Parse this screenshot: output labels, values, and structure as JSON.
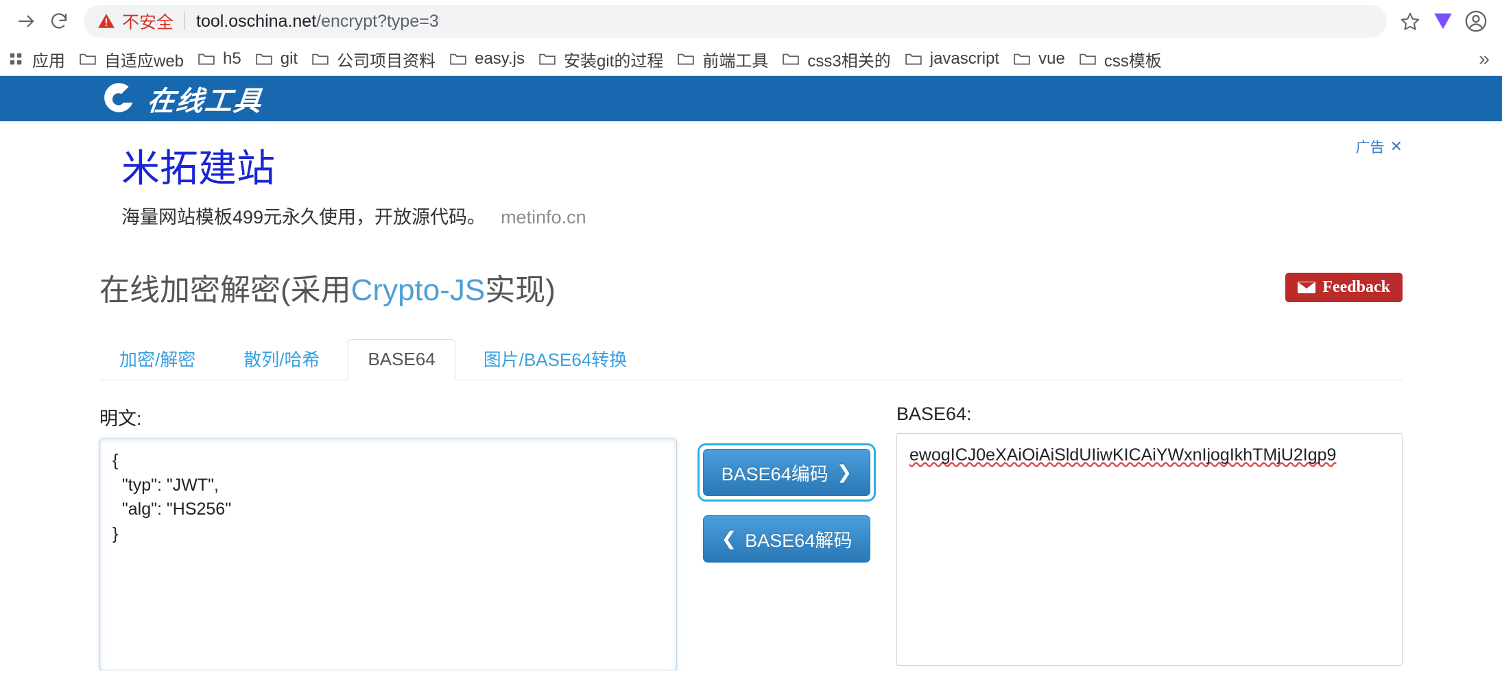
{
  "browser": {
    "back_icon": "back-arrow-icon",
    "forward_icon": "forward-arrow-icon",
    "reload_icon": "reload-icon",
    "security_warning": "不安全",
    "url_host": "tool.oschina.net",
    "url_path": "/encrypt?type=3",
    "star_icon": "bookmark-star-icon",
    "extension_icon": "extension-icon",
    "profile_icon": "profile-avatar-icon",
    "bookmarks": [
      {
        "label": "应用",
        "icon": "apps-icon"
      },
      {
        "label": "自适应web",
        "icon": "folder-icon"
      },
      {
        "label": "h5",
        "icon": "folder-icon"
      },
      {
        "label": "git",
        "icon": "folder-icon"
      },
      {
        "label": "公司项目资料",
        "icon": "folder-icon"
      },
      {
        "label": "easy.js",
        "icon": "folder-icon"
      },
      {
        "label": "安装git的过程",
        "icon": "folder-icon"
      },
      {
        "label": "前端工具",
        "icon": "folder-icon"
      },
      {
        "label": "css3相关的",
        "icon": "folder-icon"
      },
      {
        "label": "javascript",
        "icon": "folder-icon"
      },
      {
        "label": "vue",
        "icon": "folder-icon"
      },
      {
        "label": "css模板",
        "icon": "folder-icon"
      }
    ],
    "bookmarks_overflow": "»"
  },
  "site": {
    "logo_text": "在线工具",
    "header_color": "#1868b0"
  },
  "ad": {
    "badge": "广告",
    "close": "✕",
    "title": "米拓建站",
    "subtitle": "海量网站模板499元永久使用，开放源代码。",
    "domain": "metinfo.cn",
    "title_color": "#1a24d6"
  },
  "header": {
    "title_prefix": "在线加密解密(采用",
    "title_highlight": "Crypto-JS",
    "title_suffix": "实现)",
    "feedback_label": "Feedback",
    "feedback_icon": "envelope-icon",
    "feedback_color": "#bb2b2b"
  },
  "tabs": [
    {
      "label": "加密/解密",
      "active": false
    },
    {
      "label": "散列/哈希",
      "active": false
    },
    {
      "label": "BASE64",
      "active": true
    },
    {
      "label": "图片/BASE64转换",
      "active": false
    }
  ],
  "main": {
    "plaintext_label": "明文:",
    "plaintext_value": "{\n  \"typ\": \"JWT\",\n  \"alg\": \"HS256\"\n}",
    "encode_button": "BASE64编码",
    "encode_icon": "chevron-right-icon",
    "decode_button": "BASE64解码",
    "decode_icon": "chevron-left-icon",
    "base64_label": "BASE64:",
    "base64_value": "ewogICJ0eXAiOiAiSldUIiwKICAiYWxnIjogIkhTMjU2Igp9",
    "accent_color": "#2cb0e6",
    "button_color": "#2a77b5"
  }
}
